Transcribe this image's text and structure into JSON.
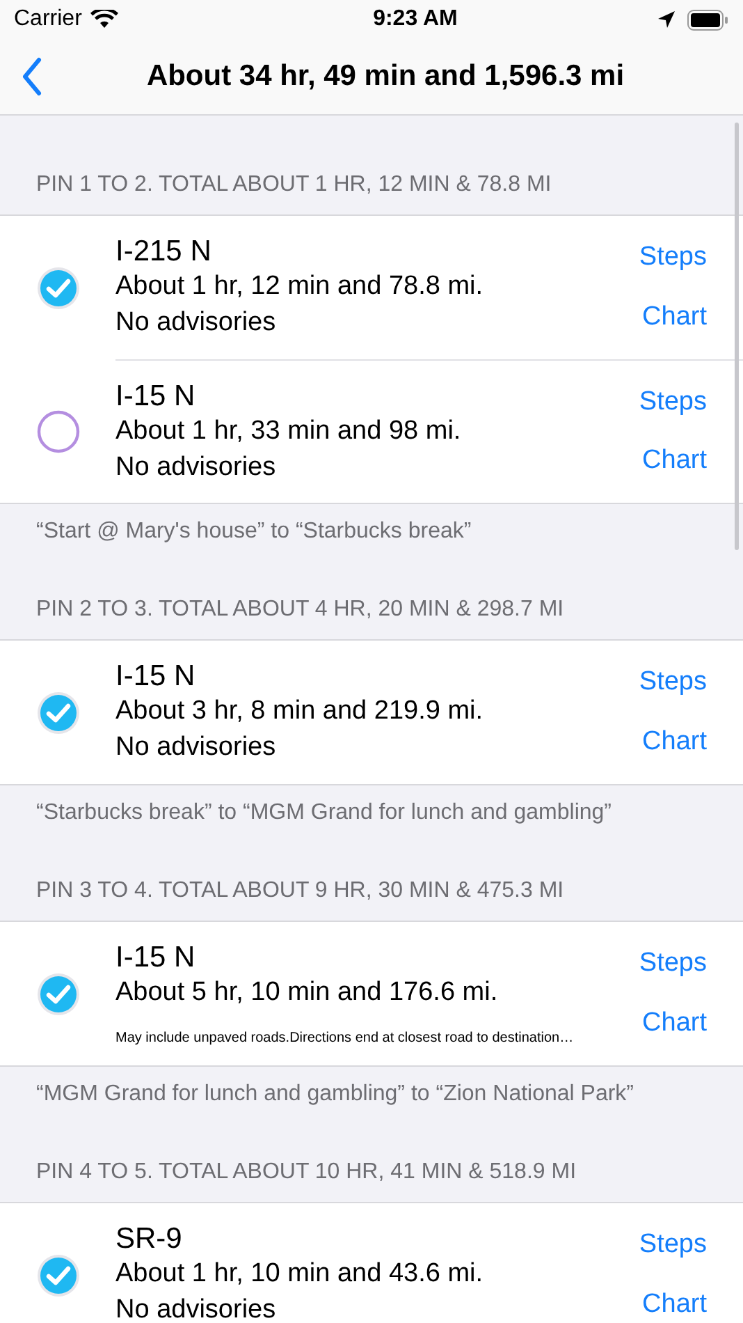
{
  "status_bar": {
    "carrier": "Carrier",
    "time": "9:23 AM"
  },
  "nav": {
    "title": "About 34 hr, 49 min and 1,596.3 mi"
  },
  "sections": [
    {
      "header": "PIN 1 TO 2. TOTAL ABOUT 1 HR, 12 MIN & 78.8 MI",
      "routes": [
        {
          "road": "I-215 N",
          "summary": "About 1 hr, 12 min and 78.8 mi.",
          "advisory": "No advisories",
          "kind": "plain",
          "selected": true,
          "steps": "Steps",
          "chart": "Chart"
        },
        {
          "road": "I-15 N",
          "summary": "About 1 hr, 33 min and 98 mi.",
          "advisory": "No advisories",
          "kind": "plain",
          "selected": false,
          "steps": "Steps",
          "chart": "Chart"
        }
      ],
      "footer": "“Start @ Mary's house” to “Starbucks break”"
    },
    {
      "header": "PIN 2 TO 3. TOTAL ABOUT 4 HR, 20 MIN & 298.7 MI",
      "routes": [
        {
          "road": "I-15 N",
          "summary": "About 3 hr, 8 min and 219.9 mi.",
          "advisory": "No advisories",
          "kind": "plain",
          "selected": true,
          "steps": "Steps",
          "chart": "Chart"
        }
      ],
      "footer": "“Starbucks break” to “MGM Grand for lunch and gambling”"
    },
    {
      "header": "PIN 3 TO 4. TOTAL ABOUT 9 HR, 30 MIN & 475.3 MI",
      "routes": [
        {
          "road": "I-15 N",
          "summary": "About 5 hr, 10 min and 176.6 mi.",
          "advisory": "May include unpaved roads.Directions end at closest road to destination…",
          "kind": "note",
          "selected": true,
          "steps": "Steps",
          "chart": "Chart"
        }
      ],
      "footer": "“MGM Grand for lunch and gambling” to “Zion National Park”"
    },
    {
      "header": "PIN 4 TO 5. TOTAL ABOUT 10 HR, 41 MIN & 518.9 MI",
      "routes": [
        {
          "road": "SR-9",
          "summary": "About 1 hr, 10 min and 43.6 mi.",
          "advisory": "No advisories",
          "kind": "plain",
          "selected": true,
          "steps": "Steps",
          "chart": "Chart"
        }
      ]
    }
  ]
}
